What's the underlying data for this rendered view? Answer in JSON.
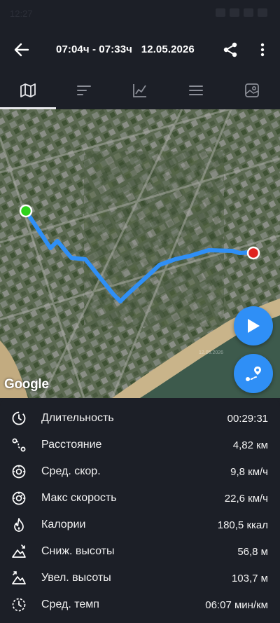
{
  "status_bar": {
    "time": "12:27"
  },
  "header": {
    "title": "07:04ч - 07:33ч   12.05.2026"
  },
  "tabs": [
    {
      "icon": "map-icon",
      "active": true
    },
    {
      "icon": "laps-icon",
      "active": false
    },
    {
      "icon": "graph-icon",
      "active": false
    },
    {
      "icon": "list-icon",
      "active": false
    },
    {
      "icon": "photo-icon",
      "active": false
    }
  ],
  "map": {
    "logo": "Google",
    "watermark": "12.05.2026",
    "start_marker_color": "#2dd21c",
    "end_marker_color": "#e0231f",
    "route_color": "#2f8ff6"
  },
  "stats": [
    {
      "icon": "timer-icon",
      "label": "Длительность",
      "value": "00:29:31"
    },
    {
      "icon": "distance-icon",
      "label": "Расстояние",
      "value": "4,82 км"
    },
    {
      "icon": "speedometer-icon",
      "label": "Сред. скор.",
      "value": "9,8 км/ч"
    },
    {
      "icon": "max-speed-icon",
      "label": "Макс скорость",
      "value": "22,6 км/ч"
    },
    {
      "icon": "flame-icon",
      "label": "Калории",
      "value": "180,5 ккал"
    },
    {
      "icon": "descent-icon",
      "label": "Сниж. высоты",
      "value": "56,8 м"
    },
    {
      "icon": "ascent-icon",
      "label": "Увел. высоты",
      "value": "103,7 м"
    },
    {
      "icon": "pace-icon",
      "label": "Сред. темп",
      "value": "06:07 мин/км"
    }
  ],
  "colors": {
    "background": "#1c1f27",
    "accent": "#2f8ff6"
  }
}
